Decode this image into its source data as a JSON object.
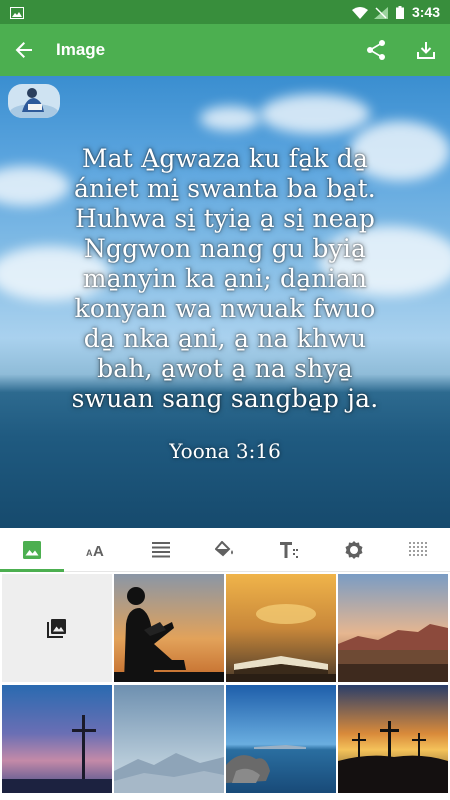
{
  "status": {
    "time": "3:43"
  },
  "app_bar": {
    "title": "Image"
  },
  "verse": {
    "lines": [
      "Mat A̱gwaza ku fa̱k da̱",
      "ániet mi̱ swanta ba ba̱t.",
      "Huhwa si̱ tyia̱ a̱ si̱ neap",
      "Nggwon nang gu byia̱",
      "ma̱nyin ka a̱ni; da̱nian",
      "konyan wa nwuak fwuo",
      "da̱ nka a̱ni, a̱ na khwu",
      "bah, a̱wot a̱ na shya̱",
      "swuan sang sangba̱p ja."
    ],
    "reference": "Yoona 3:16"
  },
  "tabs": [
    {
      "icon": "image-icon",
      "active": true
    },
    {
      "icon": "text-size-icon",
      "active": false
    },
    {
      "icon": "align-icon",
      "active": false
    },
    {
      "icon": "fill-color-icon",
      "active": false
    },
    {
      "icon": "text-format-icon",
      "active": false
    },
    {
      "icon": "settings-icon",
      "active": false
    },
    {
      "icon": "pattern-icon",
      "active": false
    }
  ],
  "thumbnails": [
    "add-photo",
    "boy-reading-silhouette",
    "open-book-sunset",
    "desert-mountains-sunset",
    "cross-at-dusk",
    "misty-mountains",
    "lake-rocks",
    "three-crosses-sunset"
  ],
  "colors": {
    "primary": "#4caf50",
    "primary_dark": "#388e3c"
  }
}
